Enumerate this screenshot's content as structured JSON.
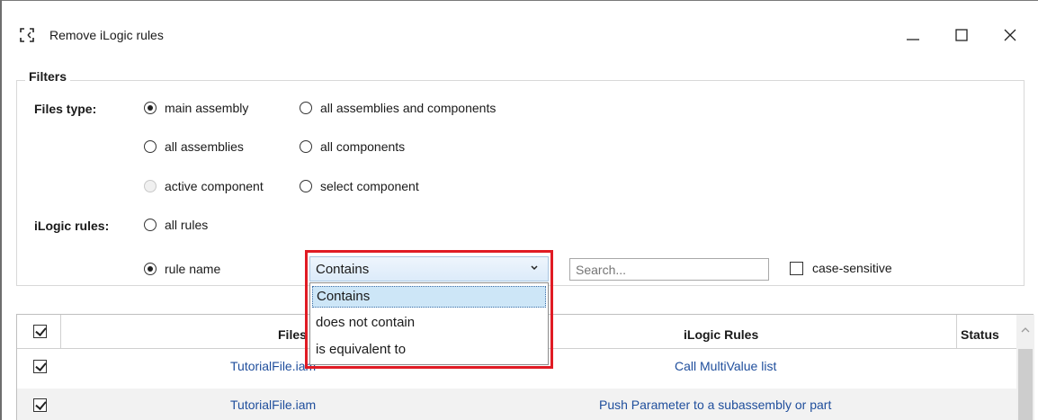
{
  "window": {
    "title": "Remove iLogic rules"
  },
  "filters": {
    "legend": "Filters",
    "files_type_label": "Files type:",
    "ilogic_rules_label": "iLogic rules:",
    "files_type_options": [
      {
        "label": "main assembly",
        "checked": true,
        "disabled": false
      },
      {
        "label": "all assemblies and components",
        "checked": false,
        "disabled": false
      },
      {
        "label": "all assemblies",
        "checked": false,
        "disabled": false
      },
      {
        "label": "all components",
        "checked": false,
        "disabled": false
      },
      {
        "label": "active component",
        "checked": false,
        "disabled": true
      },
      {
        "label": "select component",
        "checked": false,
        "disabled": false
      }
    ],
    "rule_options": [
      {
        "label": "all rules",
        "checked": false
      },
      {
        "label": "rule name",
        "checked": true
      }
    ],
    "match_mode": {
      "selected": "Contains",
      "options": [
        "Contains",
        "does not contain",
        "is equivalent to"
      ]
    },
    "search_placeholder": "Search...",
    "case_sensitive": {
      "label": "case-sensitive",
      "checked": false
    }
  },
  "grid": {
    "columns": [
      "Files",
      "iLogic Rules",
      "Status"
    ],
    "header_checked": true,
    "rows": [
      {
        "checked": true,
        "file": "TutorialFile.iam",
        "rule": "Call MultiValue list",
        "status": ""
      },
      {
        "checked": true,
        "file": "TutorialFile.iam",
        "rule": "Push Parameter to a subassembly or part",
        "status": ""
      }
    ]
  },
  "colors": {
    "highlight": "#e01b24",
    "link_text": "#1f4e9c",
    "combo_bg": "#dcebfa",
    "selected_item_bg": "#cde6f7"
  }
}
